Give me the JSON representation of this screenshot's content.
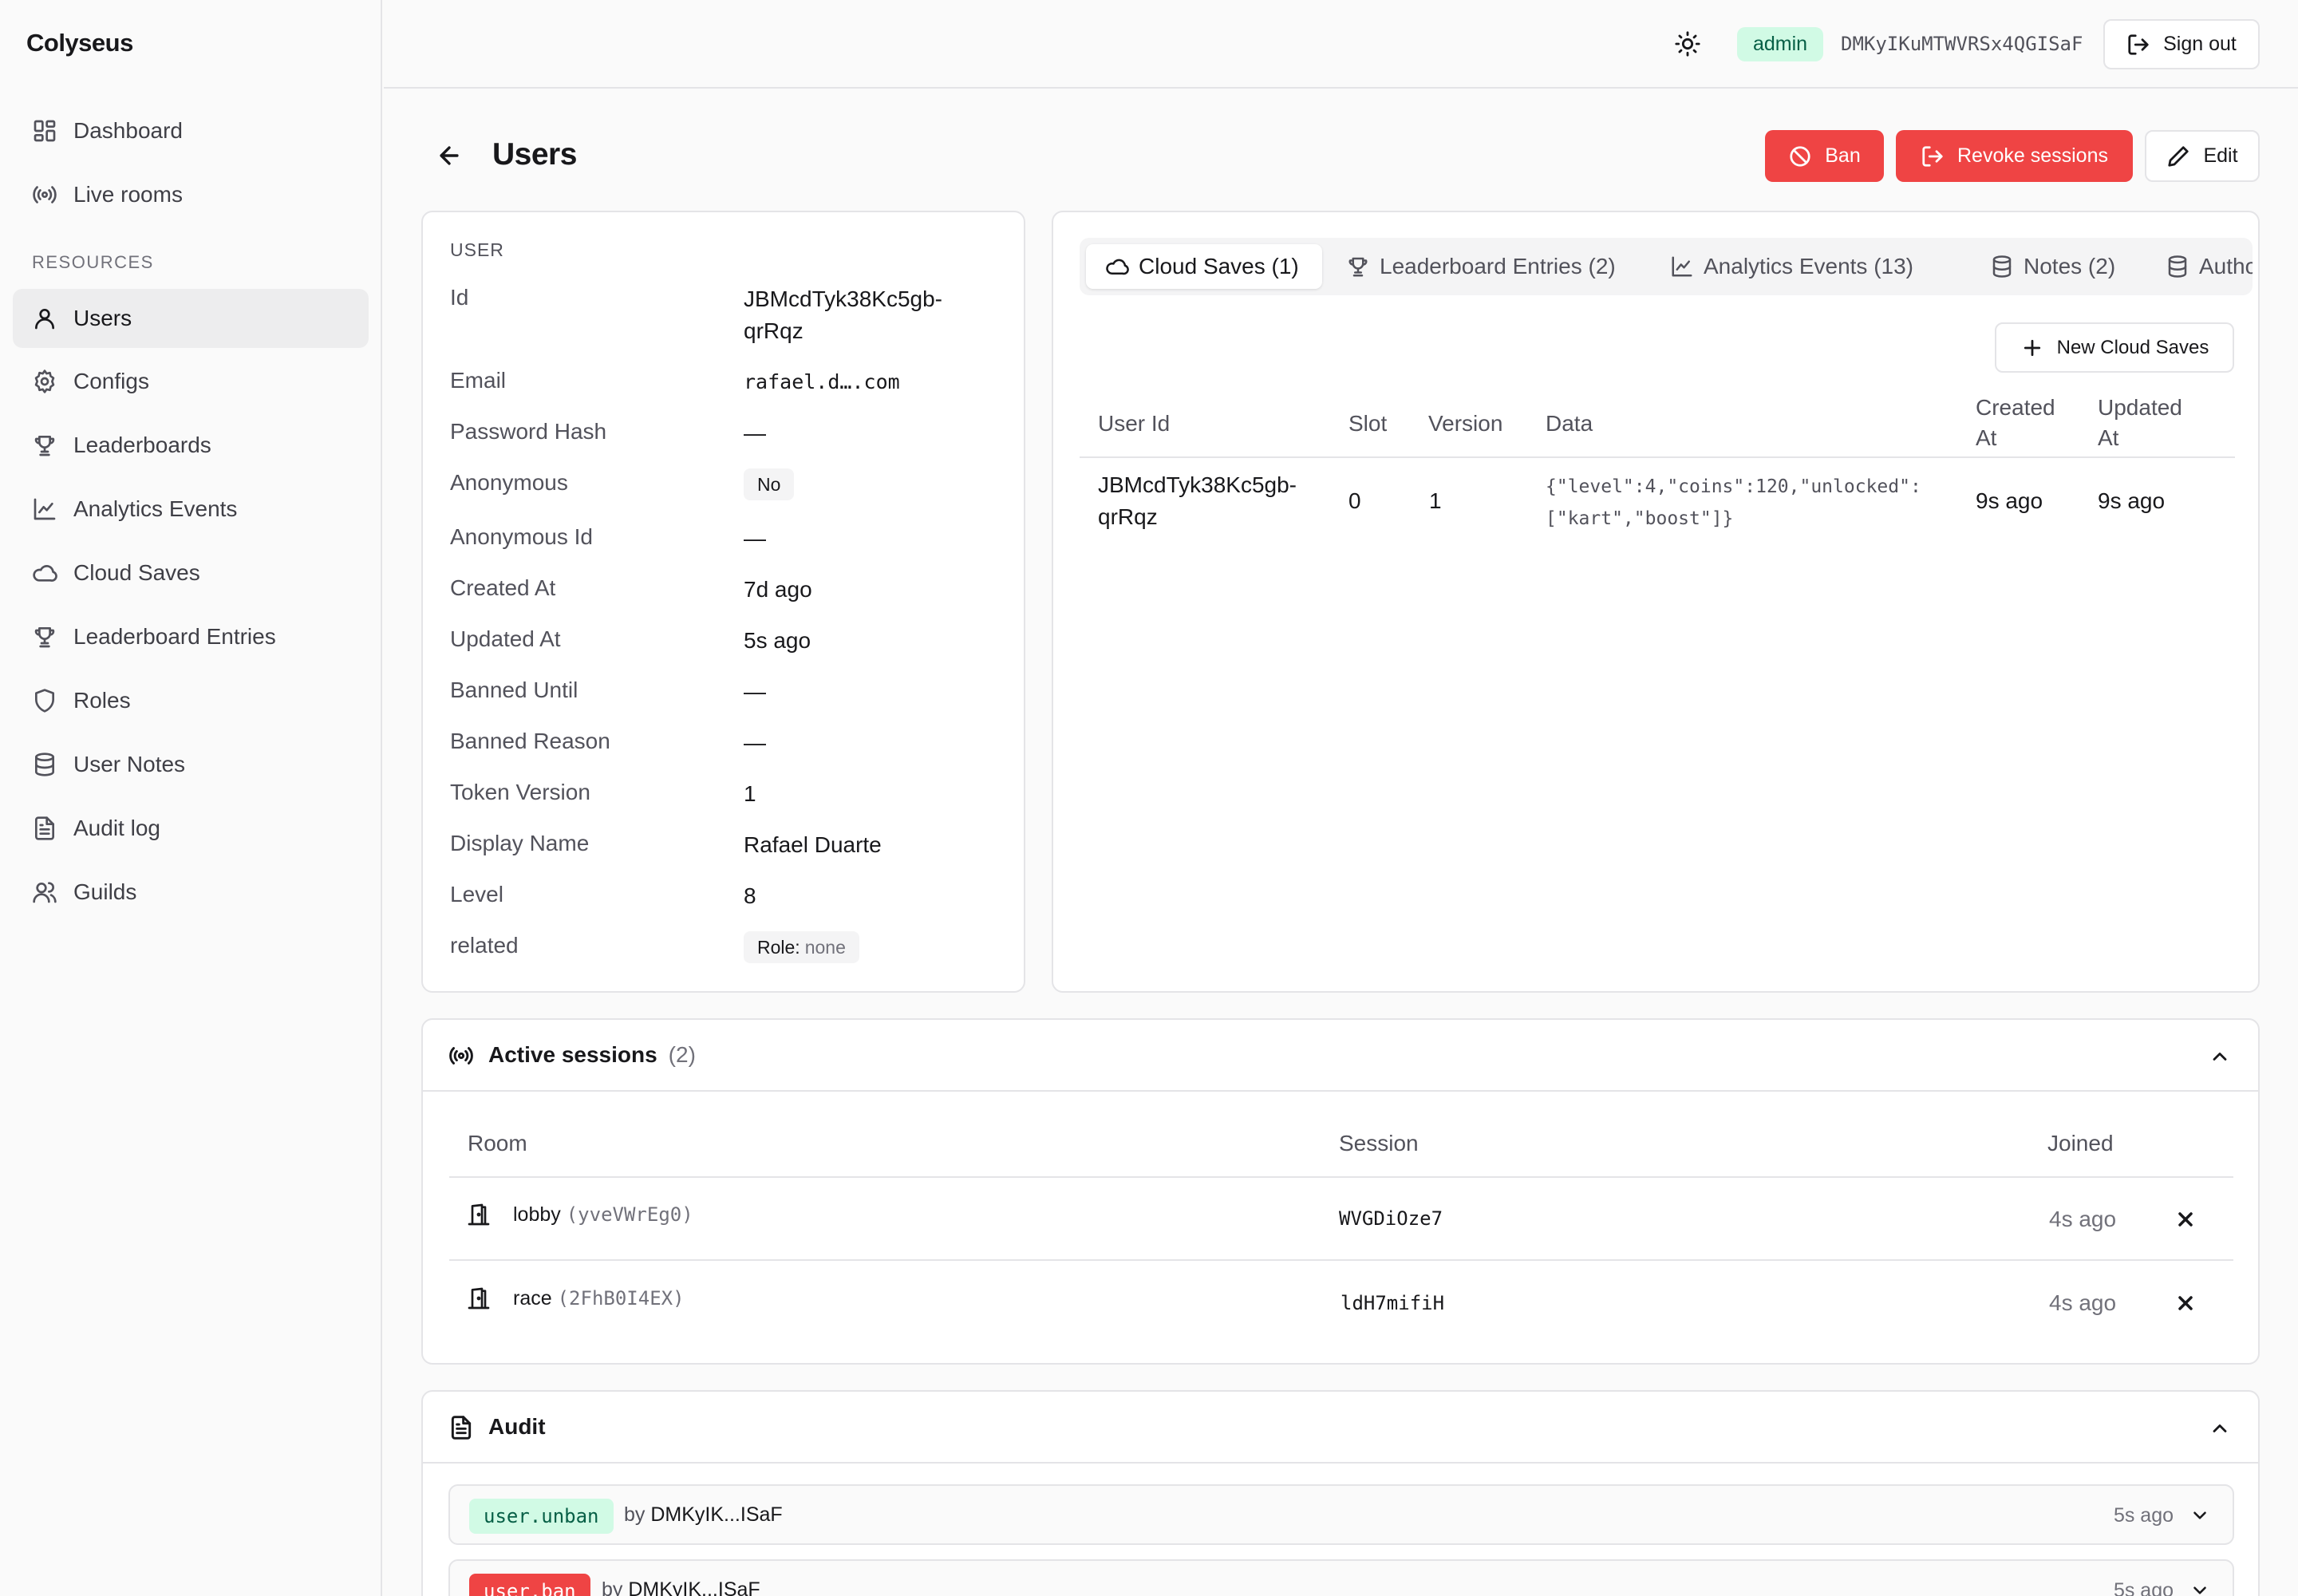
{
  "app": {
    "brand": "Colyseus"
  },
  "sidebar": {
    "top_items": [
      {
        "label": "Dashboard",
        "icon": "dashboard-icon"
      },
      {
        "label": "Live rooms",
        "icon": "radio-icon"
      }
    ],
    "section_label": "RESOURCES",
    "items": [
      {
        "label": "Users",
        "icon": "user-icon",
        "active": true
      },
      {
        "label": "Configs",
        "icon": "gear-icon"
      },
      {
        "label": "Leaderboards",
        "icon": "trophy-icon"
      },
      {
        "label": "Analytics Events",
        "icon": "chart-line-icon"
      },
      {
        "label": "Cloud Saves",
        "icon": "cloud-icon"
      },
      {
        "label": "Leaderboard Entries",
        "icon": "trophy-icon"
      },
      {
        "label": "Roles",
        "icon": "shield-icon"
      },
      {
        "label": "User Notes",
        "icon": "database-icon"
      },
      {
        "label": "Audit log",
        "icon": "file-text-icon"
      },
      {
        "label": "Guilds",
        "icon": "users-icon"
      }
    ]
  },
  "topbar": {
    "role_badge": "admin",
    "user_id": "DMKyIKuMTWVRSx4QGISaF",
    "sign_out_label": "Sign out"
  },
  "page": {
    "title": "Users",
    "actions": {
      "ban": "Ban",
      "revoke": "Revoke sessions",
      "edit": "Edit"
    }
  },
  "user_card": {
    "heading": "USER",
    "fields": {
      "id": {
        "label": "Id",
        "value_line1": "JBMcdTyk38Kc5gb-",
        "value_line2": "qrRqz"
      },
      "email": {
        "label": "Email",
        "value": "rafael.d….com"
      },
      "password_hash": {
        "label": "Password Hash",
        "value": "—"
      },
      "anonymous": {
        "label": "Anonymous",
        "value": "No"
      },
      "anonymous_id": {
        "label": "Anonymous Id",
        "value": "—"
      },
      "created_at": {
        "label": "Created At",
        "value": "7d ago"
      },
      "updated_at": {
        "label": "Updated At",
        "value": "5s ago"
      },
      "banned_until": {
        "label": "Banned Until",
        "value": "—"
      },
      "banned_reason": {
        "label": "Banned Reason",
        "value": "—"
      },
      "token_version": {
        "label": "Token Version",
        "value": "1"
      },
      "display_name": {
        "label": "Display Name",
        "value": "Rafael Duarte"
      },
      "level": {
        "label": "Level",
        "value": "8"
      },
      "related": {
        "label": "related",
        "role_key": "Role:",
        "role_value": "none"
      }
    }
  },
  "tabs": [
    {
      "label": "Cloud Saves (1)",
      "icon": "cloud-icon",
      "active": true
    },
    {
      "label": "Leaderboard Entries (2)",
      "icon": "trophy-icon"
    },
    {
      "label": "Analytics Events (13)",
      "icon": "chart-line-icon"
    },
    {
      "label": "Notes (2)",
      "icon": "database-icon"
    },
    {
      "label": "Authori",
      "icon": "database-icon"
    }
  ],
  "cloud_saves": {
    "new_button": "New Cloud Saves",
    "columns": {
      "user_id": "User Id",
      "slot": "Slot",
      "version": "Version",
      "data": "Data",
      "created_at_1": "Created",
      "created_at_2": "At",
      "updated_at_1": "Updated",
      "updated_at_2": "At"
    },
    "rows": [
      {
        "user_id_line1": "JBMcdTyk38Kc5gb-",
        "user_id_line2": "qrRqz",
        "slot": "0",
        "version": "1",
        "data_line1": "{\"level\":4,\"coins\":120,\"unlocked\":",
        "data_line2": "[\"kart\",\"boost\"]}",
        "created_at": "9s ago",
        "updated_at": "9s ago"
      }
    ]
  },
  "sessions": {
    "title": "Active sessions",
    "count": "(2)",
    "columns": {
      "room": "Room",
      "session": "Session",
      "joined": "Joined"
    },
    "rows": [
      {
        "room": "lobby",
        "room_id": "(yveVWrEg0)",
        "session": "WVGDiOze7",
        "joined": "4s ago"
      },
      {
        "room": "race",
        "room_id": "(2FhB0I4EX)",
        "session": "ldH7mifiH",
        "joined": "4s ago"
      }
    ]
  },
  "audit": {
    "title": "Audit",
    "rows": [
      {
        "action": "user.unban",
        "by_prefix": "by",
        "actor": "DMKyIK...ISaF",
        "time": "5s ago",
        "color": "#d1fae5"
      },
      {
        "action": "user.ban",
        "by_prefix": "by",
        "actor": "DMKyIK...ISaF",
        "time": "5s ago",
        "color": "#ef4444"
      }
    ]
  },
  "colors": {
    "accent_red": "#ef4444",
    "badge_green": "#d1fae5",
    "active_bg": "#ededee"
  }
}
